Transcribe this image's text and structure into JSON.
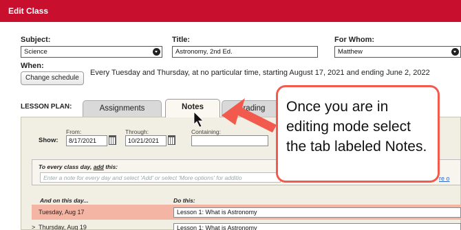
{
  "window": {
    "title": "Edit Class"
  },
  "form": {
    "subject": {
      "label": "Subject:",
      "value": "Science"
    },
    "title": {
      "label": "Title:",
      "value": "Astronomy, 2nd Ed."
    },
    "for_whom": {
      "label": "For Whom:",
      "value": "Matthew"
    },
    "when": {
      "label": "When:",
      "button": "Change schedule",
      "text": "Every Tuesday and Thursday, at no particular time, starting August 17, 2021 and ending June 2, 2022"
    }
  },
  "lesson_plan": {
    "label": "LESSON PLAN:",
    "tabs": [
      {
        "label": "Assignments",
        "active": false
      },
      {
        "label": "Notes",
        "active": true
      },
      {
        "label": "Grading",
        "active": false
      }
    ],
    "show": {
      "label": "Show:",
      "from_label": "From:",
      "from_value": "8/17/2021",
      "through_label": "Through:",
      "through_value": "10/21/2021",
      "containing_label": "Containing:",
      "containing_value": ""
    },
    "every_day": {
      "heading_prefix": "To every class day, ",
      "heading_link": "add",
      "heading_suffix": " this:",
      "placeholder": "Enter a note for every day and select 'Add' or select 'More options' for additio"
    },
    "table": {
      "col1": "And on this day...",
      "col2": "Do this:",
      "rows": [
        {
          "day": "Tuesday, Aug 17",
          "text": "Lesson 1: What is Astronomy",
          "highlight": true
        },
        {
          "day": "Thursday, Aug 19",
          "text": "Lesson 1: What is Astronomy",
          "highlight": false
        }
      ]
    },
    "more_options_partial": "re o"
  },
  "callout": {
    "text": "Once you are in editing mode select the tab labeled Notes.",
    "border_color": "#f25a4d"
  },
  "colors": {
    "titlebar": "#c8102e",
    "row_highlight": "#f5b5a5",
    "arrow": "#f25a4d"
  }
}
